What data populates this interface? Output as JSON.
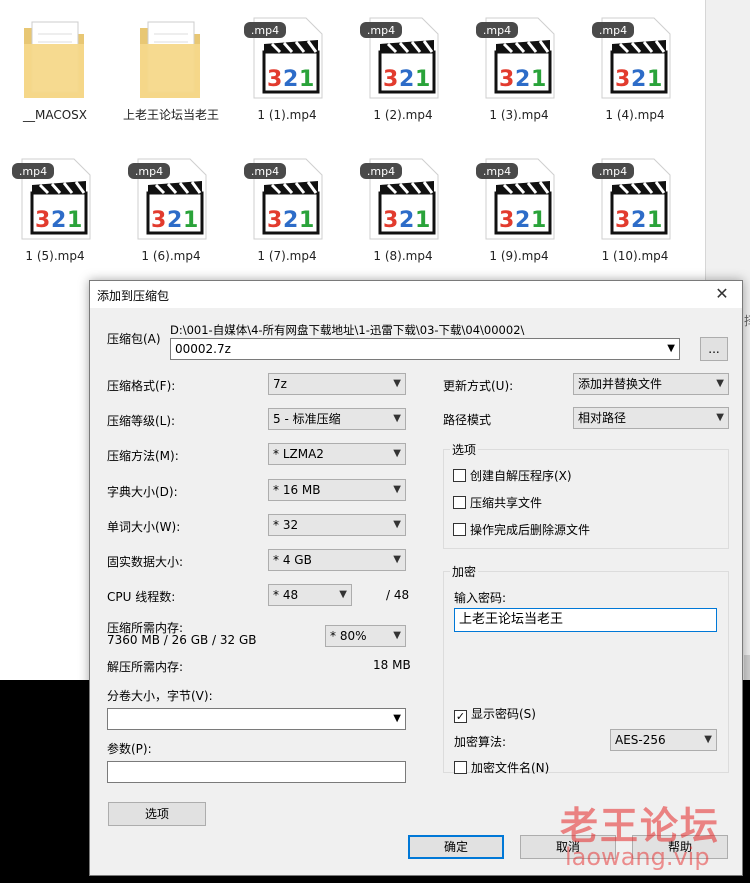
{
  "explorer": {
    "items": [
      {
        "type": "folder",
        "label": "__MACOSX"
      },
      {
        "type": "folder",
        "label": "上老王论坛当老王"
      },
      {
        "type": "mp4",
        "badge": ".mp4",
        "label": "1 (1).mp4"
      },
      {
        "type": "mp4",
        "badge": ".mp4",
        "label": "1 (2).mp4"
      },
      {
        "type": "mp4",
        "badge": ".mp4",
        "label": "1 (3).mp4"
      },
      {
        "type": "mp4",
        "badge": ".mp4",
        "label": "1 (4).mp4"
      },
      {
        "type": "mp4",
        "badge": ".mp4",
        "label": "1 (5).mp4"
      },
      {
        "type": "mp4",
        "badge": ".mp4",
        "label": "1 (6).mp4"
      },
      {
        "type": "mp4",
        "badge": ".mp4",
        "label": "1 (7).mp4"
      },
      {
        "type": "mp4",
        "badge": ".mp4",
        "label": "1 (8).mp4"
      },
      {
        "type": "mp4",
        "badge": ".mp4",
        "label": "1 (9).mp4"
      },
      {
        "type": "mp4",
        "badge": ".mp4",
        "label": "1 (10).mp4"
      }
    ],
    "icon_digits": "321",
    "right_strip_char": "择"
  },
  "dialog": {
    "title": "添加到压缩包",
    "close_glyph": "✕",
    "archive": {
      "label": "压缩包(A)",
      "path": "D:\\001-自媒体\\4-所有网盘下载地址\\1-迅雷下载\\03-下载\\04\\00002\\",
      "value": "00002.7z",
      "browse_label": "..."
    },
    "left": {
      "format_label": "压缩格式(F):",
      "format_value": "7z",
      "level_label": "压缩等级(L):",
      "level_value": "5 - 标准压缩",
      "method_label": "压缩方法(M):",
      "method_value": "* LZMA2",
      "dict_label": "字典大小(D):",
      "dict_value": "* 16 MB",
      "word_label": "单词大小(W):",
      "word_value": "* 32",
      "solid_label": "固实数据大小:",
      "solid_value": "* 4 GB",
      "cpu_label": "CPU 线程数:",
      "cpu_value": "* 48",
      "cpu_total": "/ 48",
      "mem_label": "压缩所需内存:",
      "mem_detail": "7360 MB / 26 GB / 32 GB",
      "mem_value": "* 80%",
      "decomp_label": "解压所需内存:",
      "decomp_value": "18 MB",
      "volume_label": "分卷大小，字节(V):",
      "volume_value": "",
      "params_label": "参数(P):",
      "params_value": "",
      "options_button": "选项"
    },
    "right": {
      "update_label": "更新方式(U):",
      "update_value": "添加并替换文件",
      "path_label": "路径模式",
      "path_value": "相对路径",
      "options_group": "选项",
      "opt_sfx": "创建自解压程序(X)",
      "opt_shared": "压缩共享文件",
      "opt_delete": "操作完成后删除源文件",
      "encrypt_group": "加密",
      "password_label": "输入密码:",
      "password_value": "上老王论坛当老王",
      "show_password": "显示密码(S)",
      "show_password_checked": "✓",
      "algo_label": "加密算法:",
      "algo_value": "AES-256",
      "encrypt_names": "加密文件名(N)"
    },
    "buttons": {
      "ok": "确定",
      "cancel": "取消",
      "help": "帮助"
    }
  },
  "watermark": {
    "text": "老王论坛",
    "url": "laowang.vip"
  }
}
